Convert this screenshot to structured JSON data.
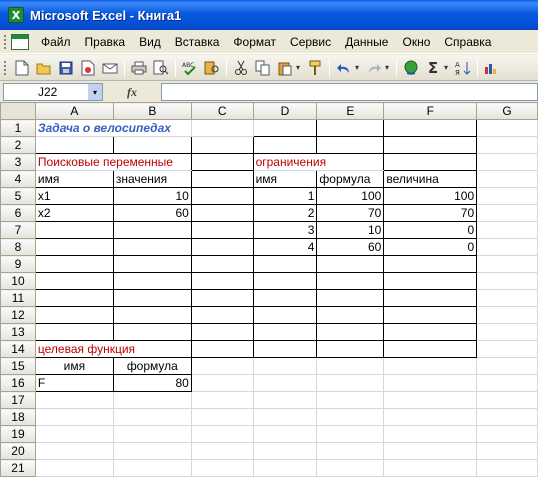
{
  "window": {
    "title": "Microsoft Excel - Книга1"
  },
  "menu": [
    "Файл",
    "Правка",
    "Вид",
    "Вставка",
    "Формат",
    "Сервис",
    "Данные",
    "Окно",
    "Справка"
  ],
  "toolbar": {
    "sigma": "Σ",
    "sort_icon": "sort-asc-icon"
  },
  "formula_bar": {
    "cell_ref": "J22",
    "fx": "fx",
    "value": ""
  },
  "columns": [
    "A",
    "B",
    "C",
    "D",
    "E",
    "F",
    "G"
  ],
  "rows": [
    {
      "n": "1",
      "A": "Задача о велосипедах",
      "B": "",
      "C": "",
      "D": "",
      "E": "",
      "F": ""
    },
    {
      "n": "2",
      "A": "",
      "B": "",
      "C": "",
      "D": "",
      "E": "",
      "F": ""
    },
    {
      "n": "3",
      "A": "Поисковые переменные",
      "B": "",
      "C": "",
      "D": "ограничения",
      "E": "",
      "F": ""
    },
    {
      "n": "4",
      "A": "имя",
      "B": "значения",
      "C": "",
      "D": "имя",
      "E": "формула",
      "F": "величина"
    },
    {
      "n": "5",
      "A": "x1",
      "B": "10",
      "C": "",
      "D": "1",
      "E": "100",
      "F": "100"
    },
    {
      "n": "6",
      "A": "x2",
      "B": "60",
      "C": "",
      "D": "2",
      "E": "70",
      "F": "70"
    },
    {
      "n": "7",
      "A": "",
      "B": "",
      "C": "",
      "D": "3",
      "E": "10",
      "F": "0"
    },
    {
      "n": "8",
      "A": "",
      "B": "",
      "C": "",
      "D": "4",
      "E": "60",
      "F": "0"
    },
    {
      "n": "9",
      "A": "",
      "B": "",
      "C": "",
      "D": "",
      "E": "",
      "F": ""
    },
    {
      "n": "10",
      "A": "",
      "B": "",
      "C": "",
      "D": "",
      "E": "",
      "F": ""
    },
    {
      "n": "11",
      "A": "",
      "B": "",
      "C": "",
      "D": "",
      "E": "",
      "F": ""
    },
    {
      "n": "12",
      "A": "",
      "B": "",
      "C": "",
      "D": "",
      "E": "",
      "F": ""
    },
    {
      "n": "13",
      "A": "",
      "B": "",
      "C": "",
      "D": "",
      "E": "",
      "F": ""
    },
    {
      "n": "14",
      "A": "целевая функция",
      "B": "",
      "C": "",
      "D": "",
      "E": "",
      "F": ""
    },
    {
      "n": "15",
      "A": "имя",
      "B": "формула",
      "C": "",
      "D": "",
      "E": "",
      "F": ""
    },
    {
      "n": "16",
      "A": "F",
      "B": "80",
      "C": "",
      "D": "",
      "E": "",
      "F": ""
    },
    {
      "n": "17",
      "A": "",
      "B": "",
      "C": "",
      "D": "",
      "E": "",
      "F": ""
    },
    {
      "n": "18",
      "A": "",
      "B": "",
      "C": "",
      "D": "",
      "E": "",
      "F": ""
    },
    {
      "n": "19",
      "A": "",
      "B": "",
      "C": "",
      "D": "",
      "E": "",
      "F": ""
    },
    {
      "n": "20",
      "A": "",
      "B": "",
      "C": "",
      "D": "",
      "E": "",
      "F": ""
    },
    {
      "n": "21",
      "A": "",
      "B": "",
      "C": "",
      "D": "",
      "E": "",
      "F": ""
    }
  ]
}
